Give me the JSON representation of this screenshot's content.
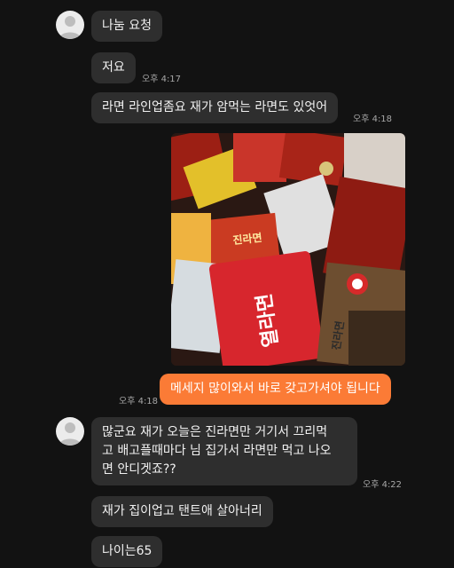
{
  "messages": [
    {
      "id": "m1",
      "text": "나눔 요청",
      "time": ""
    },
    {
      "id": "m2",
      "text": "저요",
      "time": "오후 4:17"
    },
    {
      "id": "m3",
      "text": "라면 라인업좀요 재가 암먹는 라면도 있엇어",
      "time": "오후 4:18"
    },
    {
      "id": "m4",
      "text": "메세지 많이와서 바로 갖고가셔야 됩니다",
      "time": "오후 4:18"
    },
    {
      "id": "m5",
      "lines": [
        "많군요 재가 오늘은 진라면만 거기서 끄리먹",
        "고 배고플때마다 님 집가서 라면만 먹고 나오",
        "면 안디겟죠??"
      ],
      "time": "오후 4:22"
    },
    {
      "id": "m6",
      "text": "재가 집이업고 탠트애 살아너리",
      "time": ""
    },
    {
      "id": "m7",
      "text": "나이는65",
      "time": ""
    }
  ],
  "photo": {
    "package_texts": [
      "진라면",
      "열라면",
      "진라면"
    ]
  },
  "colors": {
    "background": "#121212",
    "incoming_bubble": "#2e2e2e",
    "outgoing_bubble": "#fb7b36"
  },
  "icons": {
    "avatar": "default-profile-icon"
  }
}
